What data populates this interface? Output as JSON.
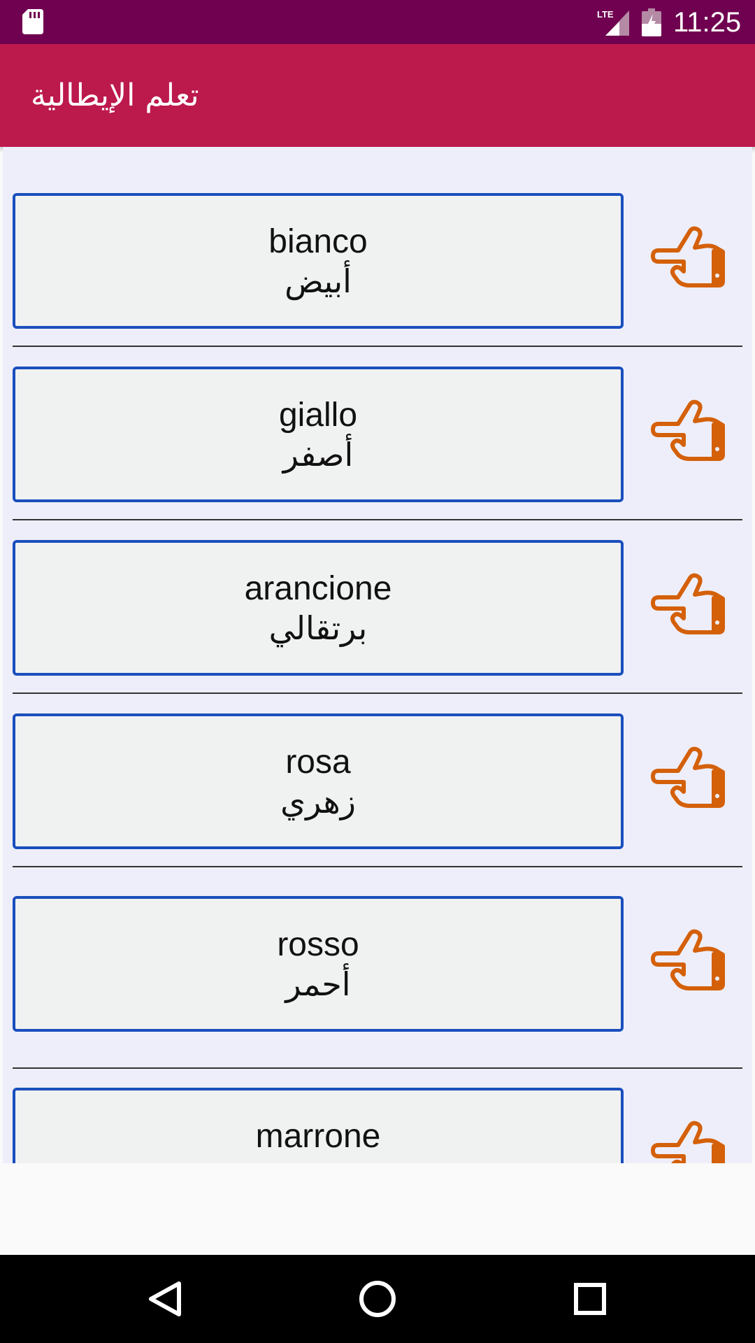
{
  "status_bar": {
    "time": "11:25",
    "network": "LTE",
    "icons": [
      "sd-card-icon",
      "signal-icon",
      "battery-charging-icon"
    ]
  },
  "app_bar": {
    "title": "تعلم الإيطالية"
  },
  "words": [
    {
      "italian": "bianco",
      "arabic": "أبيض"
    },
    {
      "italian": "giallo",
      "arabic": "أصفر"
    },
    {
      "italian": "arancione",
      "arabic": "برتقالي"
    },
    {
      "italian": "rosa",
      "arabic": "زهري"
    },
    {
      "italian": "rosso",
      "arabic": "أحمر"
    },
    {
      "italian": "marrone",
      "arabic": ""
    }
  ],
  "colors": {
    "status_bar": "#700050",
    "app_bar": "#bc194d",
    "card_border": "#1a4fbd",
    "hand_icon": "#d4600a",
    "list_background": "#eeeefa"
  },
  "nav_bar": {
    "icons": [
      "back-icon",
      "home-icon",
      "recents-icon"
    ]
  }
}
